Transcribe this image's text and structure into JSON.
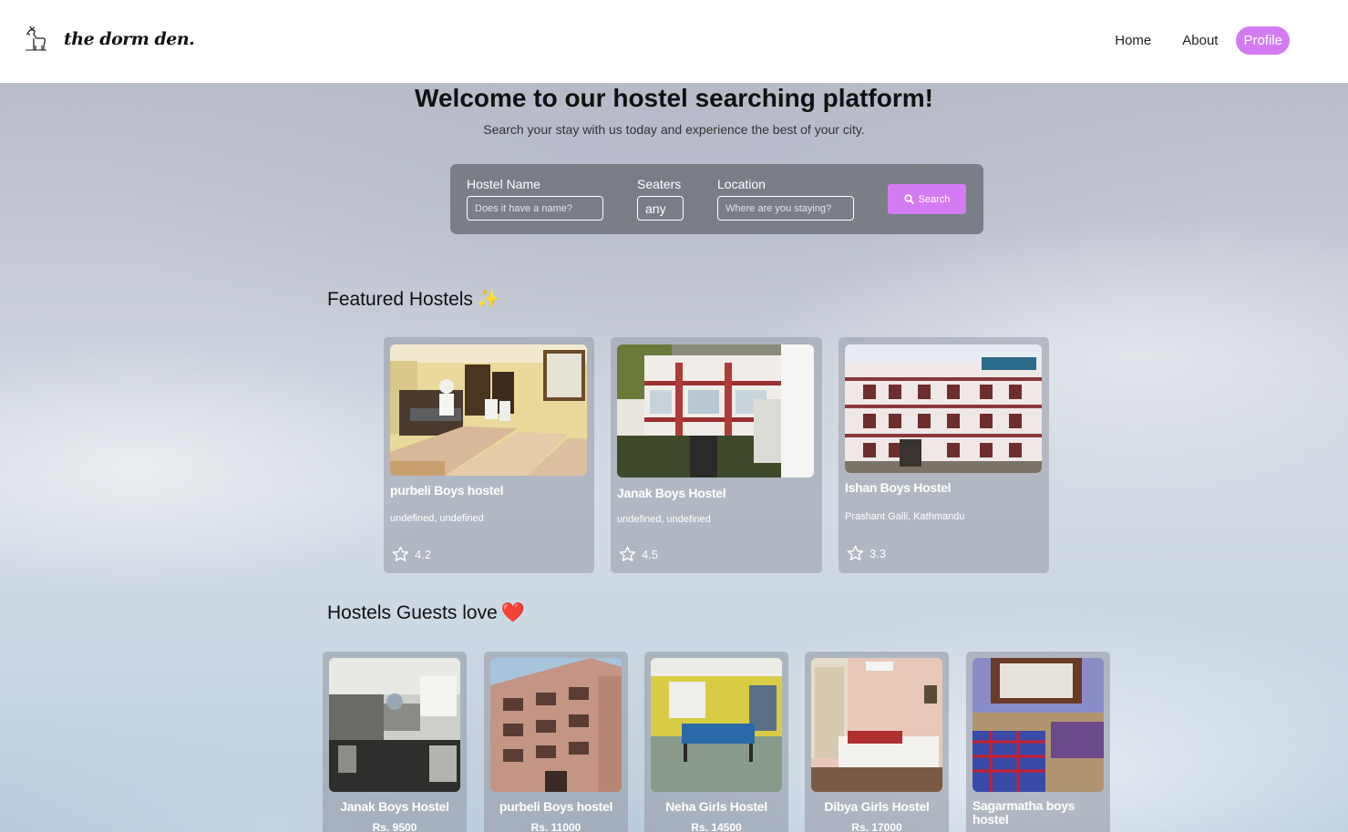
{
  "brand": {
    "name": "the dorm den."
  },
  "nav": {
    "home": "Home",
    "about": "About",
    "profile": "Profile"
  },
  "hero": {
    "title": "Welcome to our hostel searching platform!",
    "subtitle": "Search your stay with us today and experience the best of your city."
  },
  "search": {
    "hostel_name_label": "Hostel Name",
    "hostel_name_placeholder": "Does it have a name?",
    "seaters_label": "Seaters",
    "seaters_value": "any",
    "location_label": "Location",
    "location_placeholder": "Where are you staying?",
    "button_label": "Search",
    "button_icon": "search-icon"
  },
  "featured": {
    "title": "Featured Hostels",
    "emoji": "✨",
    "cards": [
      {
        "name": "purbeli Boys hostel",
        "location": "undefined, undefined",
        "rating": "4.2"
      },
      {
        "name": "Janak Boys Hostel",
        "location": "undefined, undefined",
        "rating": "4.5"
      },
      {
        "name": "Ishan Boys Hostel",
        "location": "Prashant Galli, Kathmandu",
        "rating": "3.3"
      }
    ]
  },
  "loved": {
    "title": "Hostels Guests love",
    "emoji": "❤️",
    "cards": [
      {
        "name": "Janak Boys Hostel",
        "price": "Rs. 9500"
      },
      {
        "name": "purbeli Boys hostel",
        "price": "Rs. 11000"
      },
      {
        "name": "Neha Girls Hostel",
        "price": "Rs. 14500"
      },
      {
        "name": "Dibya Girls Hostel",
        "price": "Rs. 17000"
      },
      {
        "name": "Sagarmatha boys hostel",
        "price": ""
      }
    ]
  },
  "colors": {
    "accent": "#d37cf2",
    "panel": "#6e727a"
  }
}
